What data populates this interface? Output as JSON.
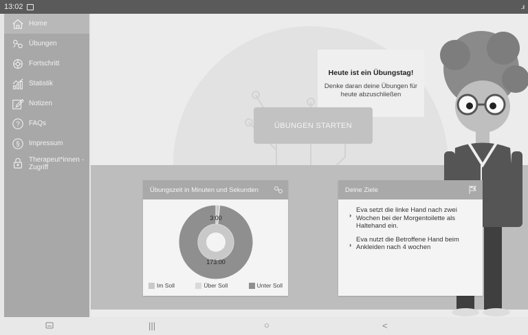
{
  "statusbar": {
    "time": "13:02",
    "signal": "..ıl"
  },
  "sidebar": {
    "items": [
      {
        "label": "Home",
        "icon": "home-icon",
        "active": true
      },
      {
        "label": "Übungen",
        "icon": "exercises-icon"
      },
      {
        "label": "Fortschritt",
        "icon": "progress-icon"
      },
      {
        "label": "Statistik",
        "icon": "statistics-icon"
      },
      {
        "label": "Notizen",
        "icon": "notes-icon"
      },
      {
        "label": "FAQs",
        "icon": "faq-icon"
      },
      {
        "label": "Impressum",
        "icon": "imprint-icon"
      },
      {
        "label": "Therapeut*innen -Zugriff",
        "icon": "lock-icon"
      }
    ]
  },
  "speech": {
    "title": "Heute ist ein Übungstag!",
    "text": "Denke daran deine Übungen für heute abzuschließen"
  },
  "start_button": "ÜBUNGEN STARTEN",
  "time_card": {
    "title": "Übungszeit in Minuten und Sekunden",
    "icon": "exercises-icon",
    "chart_data": {
      "type": "pie",
      "categories": [
        "Im Soll",
        "Über Soll",
        "Unter Soll"
      ],
      "values": [
        3,
        0,
        173
      ],
      "data_labels": [
        "3:00",
        "173:00"
      ]
    },
    "legend": [
      "Im Soll",
      "Über Soll",
      "Unter Soll"
    ],
    "colors": {
      "im_soll": "#c9c9c9",
      "ueber_soll": "#d9d9d9",
      "unter_soll": "#8f8f8f"
    }
  },
  "goals_card": {
    "title": "Deine Ziele",
    "icon": "flag-icon",
    "goals": [
      "Eva setzt die linke Hand nach zwei Wochen bei der Morgentoilette als Haltehand ein.",
      "Eva nutzt die Betroffene Hand beim Ankleiden nach 4 wochen"
    ]
  },
  "navbar": {
    "recents": "|||",
    "home": "○",
    "back": "<"
  }
}
